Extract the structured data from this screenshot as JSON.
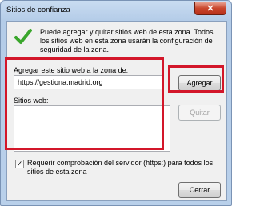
{
  "window": {
    "title": "Sitios de confianza",
    "close_glyph": "✕"
  },
  "info": {
    "text": "Puede agregar y quitar sitios web de esta zona. Todos los sitios web en esta zona usarán la configuración de seguridad de la zona.",
    "icon": "check-icon",
    "icon_color": "#3aa62c"
  },
  "add_site": {
    "label": "Agregar este sitio web a la zona de:",
    "value": "https://gestiona.madrid.org",
    "button_label": "Agregar"
  },
  "sites": {
    "label": "Sitios web:",
    "items": [],
    "remove_label": "Quitar"
  },
  "https_check": {
    "label": "Requerir comprobación del servidor (https:) para todos los sitios de esta zona",
    "checked": true,
    "check_glyph": "✓"
  },
  "footer": {
    "close_label": "Cerrar"
  },
  "highlight_color": "#d3172a"
}
